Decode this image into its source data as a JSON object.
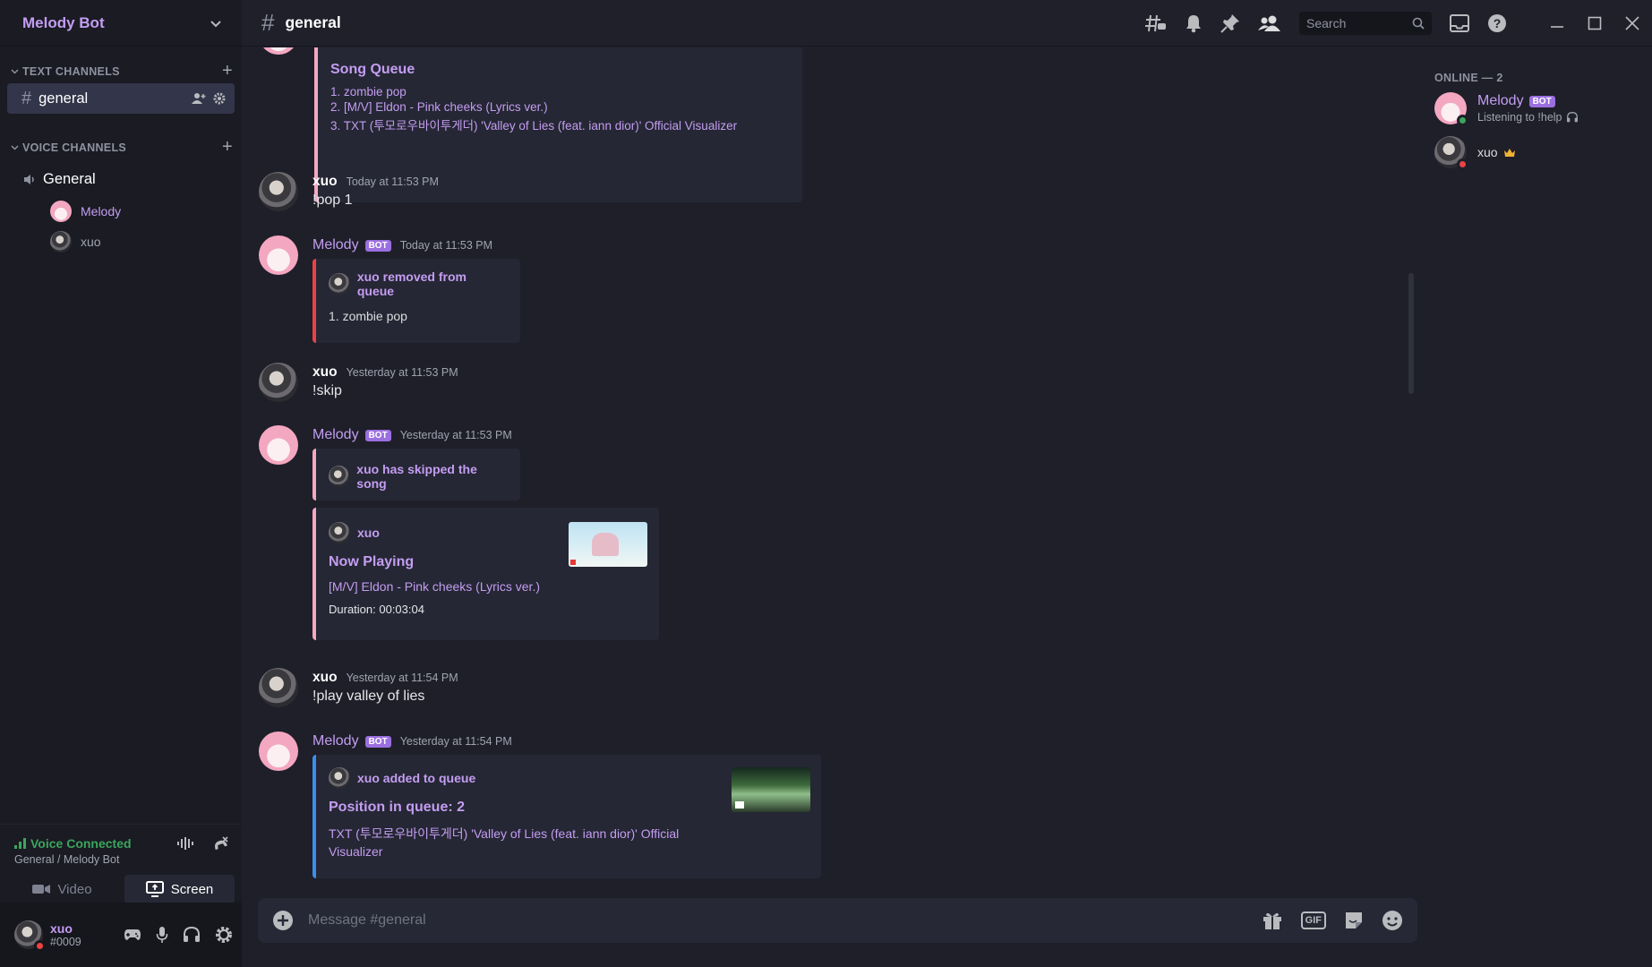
{
  "server": {
    "name": "Melody Bot"
  },
  "sidebar": {
    "text_category": "TEXT CHANNELS",
    "text_channels": [
      {
        "name": "general"
      }
    ],
    "voice_category": "VOICE CHANNELS",
    "voice_channel": "General",
    "voice_members": [
      {
        "name": "Melody"
      },
      {
        "name": "xuo"
      }
    ]
  },
  "voice_panel": {
    "status": "Voice Connected",
    "location": "General / Melody Bot",
    "video_label": "Video",
    "screen_label": "Screen"
  },
  "user_panel": {
    "name": "xuo",
    "tag": "#0009"
  },
  "topbar": {
    "channel": "general",
    "search_placeholder": "Search"
  },
  "messages": [
    {
      "embed": {
        "title": "Song Queue",
        "items": [
          "1. zombie pop",
          "2. [M/V] Eldon - Pink cheeks (Lyrics ver.)",
          "3. TXT (투모로우바이투게더) 'Valley of Lies (feat. iann dior)' Official Visualizer"
        ]
      }
    },
    {
      "author": "xuo",
      "time": "Today at 11:53 PM",
      "text": "!pop 1"
    },
    {
      "author": "Melody",
      "bot": "BOT",
      "time": "Today at 11:53 PM",
      "embed": {
        "author": "xuo removed from queue",
        "body": "1. zombie pop"
      }
    },
    {
      "author": "xuo",
      "time": "Yesterday at 11:53 PM",
      "text": "!skip"
    },
    {
      "author": "Melody",
      "bot": "BOT",
      "time": "Yesterday at 11:53 PM",
      "embed": {
        "author": "xuo has skipped the song"
      },
      "embed2": {
        "author": "xuo",
        "title": "Now Playing",
        "line": "[M/V] Eldon - Pink cheeks (Lyrics ver.)",
        "duration": "Duration: 00:03:04"
      }
    },
    {
      "author": "xuo",
      "time": "Yesterday at 11:54 PM",
      "text": "!play valley of lies"
    },
    {
      "author": "Melody",
      "bot": "BOT",
      "time": "Yesterday at 11:54 PM",
      "embed": {
        "author": "xuo added to queue",
        "title": "Position in queue: 2",
        "line1": "TXT (투모로우바이투게더) 'Valley of Lies (feat. iann dior)' Official",
        "line2": "Visualizer"
      }
    }
  ],
  "composer": {
    "placeholder": "Message #general",
    "gif_label": "GIF"
  },
  "members": {
    "header": "ONLINE — 2",
    "list": [
      {
        "name": "Melody",
        "bot": "BOT",
        "status": "Listening to !help"
      },
      {
        "name": "xuo"
      }
    ]
  },
  "colors": {
    "accent": "#c49df2",
    "online": "#3ba55d",
    "dnd": "#ed4245",
    "embed_pink": "#f4a7c0",
    "embed_red": "#ed4245",
    "embed_blue": "#3b8eea"
  }
}
